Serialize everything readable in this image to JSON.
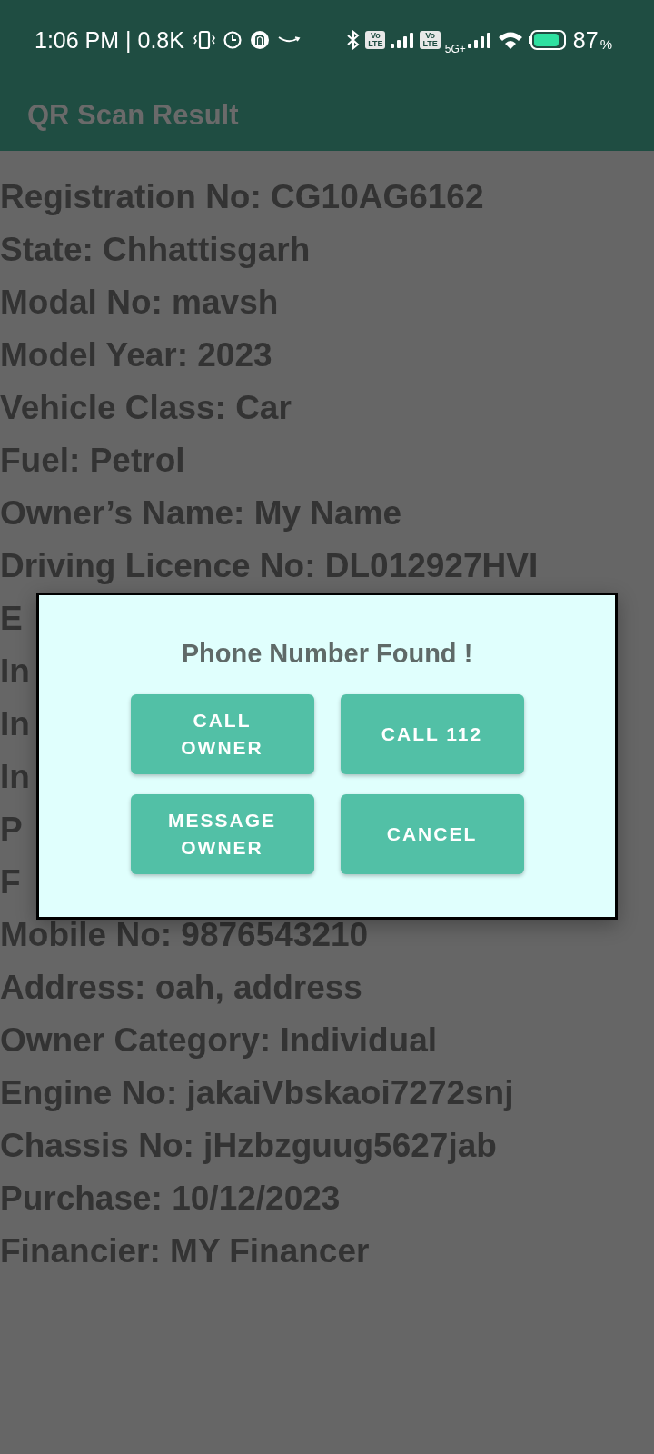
{
  "status_bar": {
    "time": "1:06 PM | 0.8K",
    "sims": [
      {
        "badge_top": "Vo",
        "badge_bottom": "LTE"
      },
      {
        "badge_top": "Vo",
        "badge_bottom": "LTE",
        "network": "5G+"
      }
    ],
    "battery": "87",
    "battery_unit": "%"
  },
  "app_bar": {
    "title": "QR Scan Result"
  },
  "details": [
    "Registration No: CG10AG6162",
    "State: Chhattisgarh",
    "Modal No: mavsh",
    "Model Year: 2023",
    "Vehicle Class: Car",
    "Fuel: Petrol",
    "Owner’s Name: My Name",
    "Driving Licence No: DL012927HVI",
    "E",
    "In",
    "In",
    "In",
    "P",
    "F",
    "Mobile No: 9876543210",
    "Address: oah, address",
    "Owner Category: Individual",
    "Engine No: jakaiVbskaoi7272snj",
    "Chassis No: jHzbzguug5627jab",
    "Purchase: 10/12/2023",
    "Financier: MY Financer"
  ],
  "dialog": {
    "title": "Phone Number Found !",
    "buttons": [
      {
        "label": "CALL\nOWNER"
      },
      {
        "label": "CALL 112"
      },
      {
        "label": "MESSAGE\nOWNER"
      },
      {
        "label": "CANCEL"
      }
    ]
  }
}
